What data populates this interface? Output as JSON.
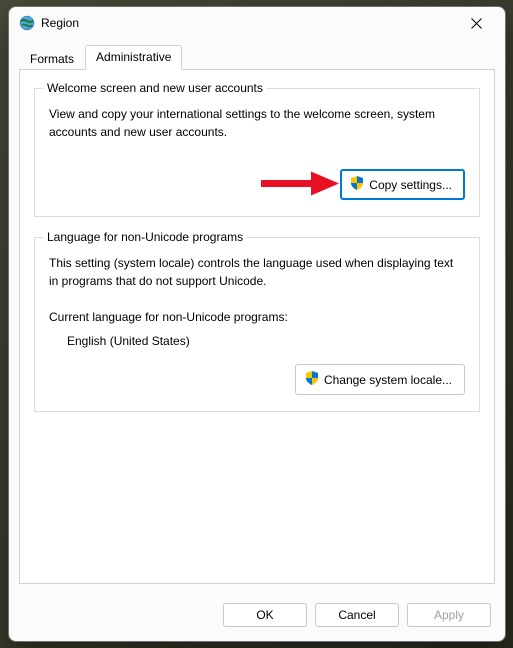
{
  "window": {
    "title": "Region"
  },
  "tabs": {
    "formats": "Formats",
    "administrative": "Administrative"
  },
  "group1": {
    "title": "Welcome screen and new user accounts",
    "desc": "View and copy your international settings to the welcome screen, system accounts and new user accounts.",
    "button": "Copy settings..."
  },
  "group2": {
    "title": "Language for non-Unicode programs",
    "desc": "This setting (system locale) controls the language used when displaying text in programs that do not support Unicode.",
    "current_label": "Current language for non-Unicode programs:",
    "current_value": "English (United States)",
    "button": "Change system locale..."
  },
  "buttons": {
    "ok": "OK",
    "cancel": "Cancel",
    "apply": "Apply"
  }
}
